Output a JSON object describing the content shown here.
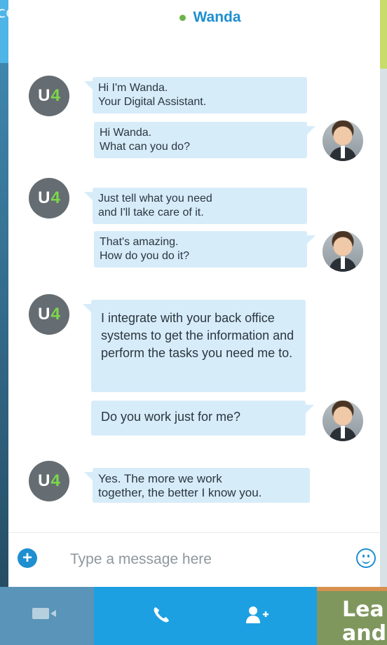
{
  "background": {
    "left_label": "ceable"
  },
  "header": {
    "contact_name": "Wanda",
    "status_color": "#6db34a"
  },
  "bot": {
    "avatar_text_u": "U",
    "avatar_text_4": "4"
  },
  "messages": [
    {
      "from": "bot",
      "lines": [
        "Hi I'm Wanda.",
        "Your Digital Assistant."
      ]
    },
    {
      "from": "user",
      "lines": [
        "Hi Wanda.",
        "What can you do?"
      ]
    },
    {
      "from": "bot",
      "lines": [
        "Just tell what you need",
        "and I'll take care of it."
      ]
    },
    {
      "from": "user",
      "lines": [
        "That's amazing.",
        "How do you do it?"
      ]
    },
    {
      "from": "bot",
      "lines": [
        "I integrate with your back office systems to get the information and perform the tasks you need me to."
      ]
    },
    {
      "from": "user",
      "lines": [
        "Do you work just for me?"
      ]
    },
    {
      "from": "bot",
      "lines": [
        "Yes. The more we work",
        "together, the better I know you."
      ]
    }
  ],
  "composer": {
    "placeholder": "Type a message here",
    "value": ""
  },
  "icons": {
    "add": "plus-icon",
    "emoji": "smiley-icon",
    "video": "video-camera-icon",
    "call": "phone-icon",
    "add_person": "add-person-icon"
  },
  "promo": {
    "text": "Lea\nand"
  },
  "colors": {
    "accent": "#1e8fd0",
    "bubble": "#d7ecf9",
    "call_bar": "#1ca0e2",
    "video_bar": "#5a94b8",
    "promo": "#7f975d"
  }
}
